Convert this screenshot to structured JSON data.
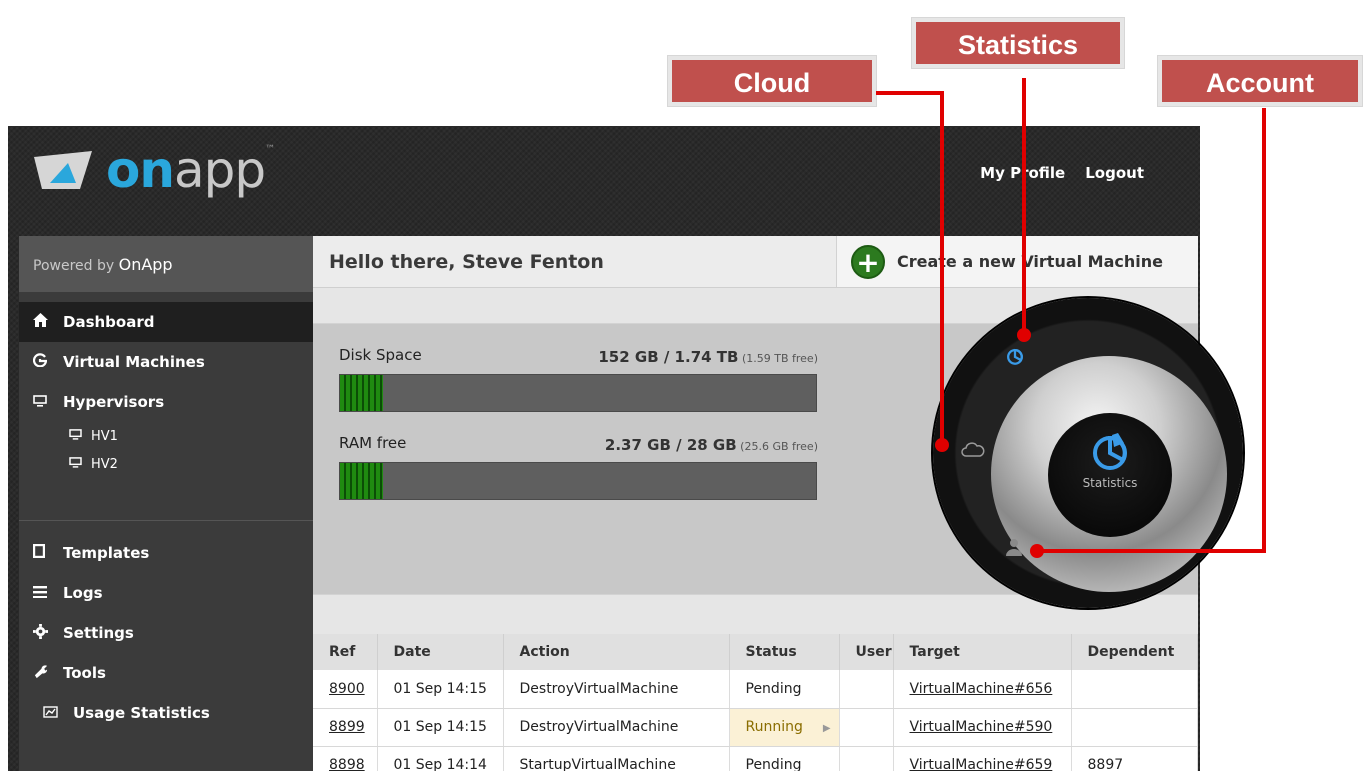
{
  "callouts": {
    "cloud": "Cloud",
    "statistics": "Statistics",
    "account": "Account",
    "color": "#c0504d"
  },
  "header": {
    "logo_on": "on",
    "logo_app": "app",
    "logo_tm": "™",
    "my_profile": "My Profile",
    "logout": "Logout"
  },
  "sidebar": {
    "powered_prefix": "Powered by ",
    "powered_brand": "OnApp",
    "items": [
      {
        "label": "Dashboard",
        "icon": "home-icon"
      },
      {
        "label": "Virtual Machines",
        "icon": "virtual-machines-icon"
      },
      {
        "label": "Hypervisors",
        "icon": "monitor-icon"
      }
    ],
    "subitems": [
      {
        "label": "HV1",
        "icon": "monitor-icon"
      },
      {
        "label": "HV2",
        "icon": "monitor-icon"
      }
    ],
    "items2": [
      {
        "label": "Templates",
        "icon": "template-icon"
      },
      {
        "label": "Logs",
        "icon": "logs-icon"
      },
      {
        "label": "Settings",
        "icon": "gear-icon"
      },
      {
        "label": "Tools",
        "icon": "wrench-icon"
      }
    ],
    "usage": {
      "label": "Usage Statistics",
      "icon": "chart-icon"
    }
  },
  "main": {
    "greeting": "Hello there, Steve Fenton",
    "create_vm": "Create a new Virtual Machine",
    "disk": {
      "label": "Disk Space",
      "value": "152 GB / 1.74 TB",
      "free": " (1.59 TB free)",
      "used_fraction": 0.09
    },
    "ram": {
      "label": "RAM free",
      "value": "2.37 GB / 28 GB",
      "free": " (25.6 GB free)",
      "used_fraction": 0.09
    },
    "dial": {
      "center_label": "Statistics"
    }
  },
  "table": {
    "columns": [
      "Ref",
      "Date",
      "Action",
      "Status",
      "User",
      "Target",
      "Dependent"
    ],
    "rows": [
      {
        "ref": "8900",
        "date": "01 Sep 14:15",
        "action": "DestroyVirtualMachine",
        "status": "Pending",
        "user": "",
        "target": "VirtualMachine#656",
        "dependent": ""
      },
      {
        "ref": "8899",
        "date": "01 Sep 14:15",
        "action": "DestroyVirtualMachine",
        "status": "Running",
        "user": "",
        "target": "VirtualMachine#590",
        "dependent": ""
      },
      {
        "ref": "8898",
        "date": "01 Sep 14:14",
        "action": "StartupVirtualMachine",
        "status": "Pending",
        "user": "",
        "target": "VirtualMachine#659",
        "dependent": "8897"
      }
    ]
  }
}
